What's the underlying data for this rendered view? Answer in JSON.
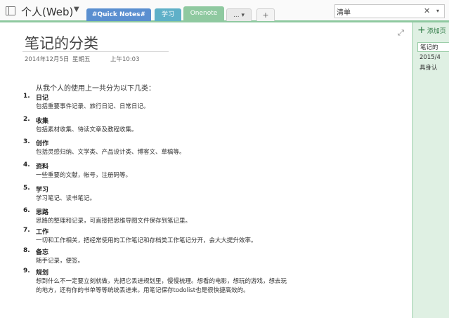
{
  "topbar": {
    "notebook_title": "个人(Web)",
    "tabs": [
      "#Quick Notes#",
      "学习",
      "Onenote",
      "... ▾",
      "+"
    ],
    "search_value": "清单",
    "search_clear": "✕",
    "search_caret": "▾"
  },
  "page": {
    "title": "笔记的分类",
    "date": "2014年12月5日",
    "weekday": "星期五",
    "time": "上午10:03",
    "intro": "从我个人的使用上一共分为以下几类：",
    "items": [
      {
        "num": "1.",
        "head": "日记",
        "desc": "包括重要事件记录、旅行日记、日常日记。"
      },
      {
        "num": "2.",
        "head": "收集",
        "desc": "包括素材收集、待读文章及教程收集。"
      },
      {
        "num": "3.",
        "head": "创作",
        "desc": "包括灵感归纳、文学类、产品设计类、博客文、草稿等。"
      },
      {
        "num": "4.",
        "head": "资料",
        "desc": "一些重要的文献，帐号，注册码等。"
      },
      {
        "num": "5.",
        "head": "学习",
        "desc": "学习笔记、读书笔记。"
      },
      {
        "num": "6.",
        "head": "思路",
        "desc": "思路的整理和记录，可直接把思维导图文件保存到笔记里。"
      },
      {
        "num": "7.",
        "head": "工作",
        "desc": "一切和工作相关，把经常使用的工作笔记和存档类工作笔记分开，会大大提升效率。"
      },
      {
        "num": "8.",
        "head": "备忘",
        "desc": "随手记录，便签。"
      },
      {
        "num": "9.",
        "head": "规划",
        "desc": "想到什么不一定要立刻就做，先把它丢进规划里，慢慢梳理。想看的电影，想玩的游戏，想去玩",
        "desc2": "的地方，还有你的书单等等统统丢进来。用笔记保存todolist也是很快捷高效的。"
      }
    ]
  },
  "pages_pane": {
    "add_label": "添加页",
    "entries": [
      "笔记的",
      "2015/4",
      "具身认"
    ]
  },
  "icons": {
    "notebook": "notebook-icon",
    "expand": "expand-icon",
    "add": "plus-icon"
  },
  "colors": {
    "accent": "#8fc9a0",
    "quick_notes_tab": "#5a8fd0",
    "study_tab": "#5fb0c8",
    "pane_bg": "#dff0e3"
  }
}
